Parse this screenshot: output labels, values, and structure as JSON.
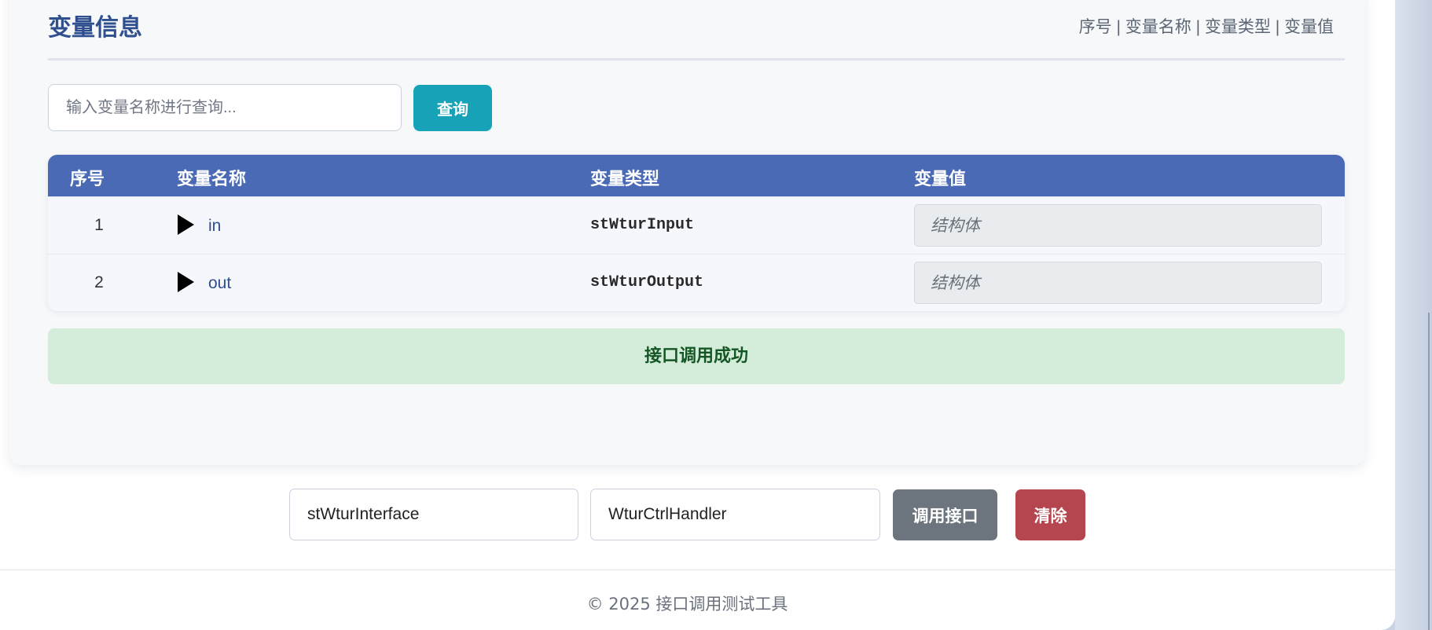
{
  "card": {
    "title": "变量信息",
    "hint": "序号 | 变量名称 | 变量类型 | 变量值"
  },
  "search": {
    "placeholder": "输入变量名称进行查询...",
    "button": "查询"
  },
  "table": {
    "headers": [
      "序号",
      "变量名称",
      "变量类型",
      "变量值"
    ],
    "rows": [
      {
        "index": "1",
        "name": "in",
        "type": "stWturInput",
        "value": "结构体"
      },
      {
        "index": "2",
        "name": "out",
        "type": "stWturOutput",
        "value": "结构体"
      }
    ]
  },
  "status": {
    "message": "接口调用成功",
    "color": "#d4edda"
  },
  "interface": {
    "interface_name": "stWturInterface",
    "handler_name": "WturCtrlHandler",
    "call_button": "调用接口",
    "clear_button": "清除"
  },
  "footer": {
    "text": "© 2025 接口调用测试工具"
  },
  "colors": {
    "accent": "#4a6ab6",
    "title": "#2f4f8f",
    "search_button": "#17a2b8",
    "call_button": "#6c757d",
    "clear_button": "#b5464f"
  },
  "icons": {
    "expand": "triangle-right-icon"
  }
}
